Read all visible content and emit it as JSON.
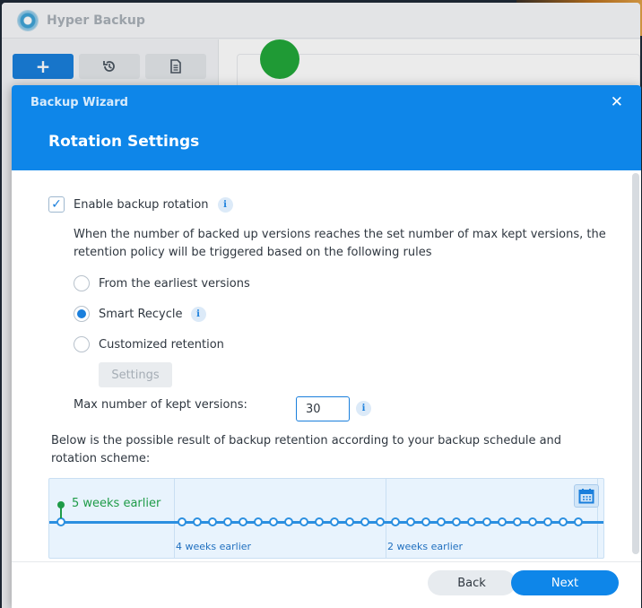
{
  "app": {
    "title": "Hyper Backup",
    "toolbar": {
      "add_label": "+",
      "history_icon": "history-icon",
      "log_icon": "log-icon"
    }
  },
  "wizard": {
    "title": "Backup Wizard",
    "step_title": "Rotation Settings",
    "close_label": "✕",
    "enable_rotation": {
      "label": "Enable backup rotation",
      "checked": true
    },
    "description": "When the number of backed up versions reaches the set number of max kept versions, the retention policy will be triggered based on the following rules",
    "policies": [
      {
        "label": "From the earliest versions",
        "selected": false
      },
      {
        "label": "Smart Recycle",
        "selected": true,
        "has_info": true
      },
      {
        "label": "Customized retention",
        "selected": false
      }
    ],
    "settings_button": "Settings",
    "max_versions": {
      "label": "Max number of kept versions:",
      "value": "30"
    },
    "result_text": "Below is the possible result of backup retention according to your backup schedule and rotation scheme:",
    "timeline": {
      "first_label": "5 weeks earlier",
      "labels": [
        "4 weeks earlier",
        "2 weeks earlier"
      ]
    },
    "buttons": {
      "back": "Back",
      "next": "Next"
    }
  },
  "colors": {
    "accent": "#0e86e9",
    "green": "#1e9b47"
  }
}
